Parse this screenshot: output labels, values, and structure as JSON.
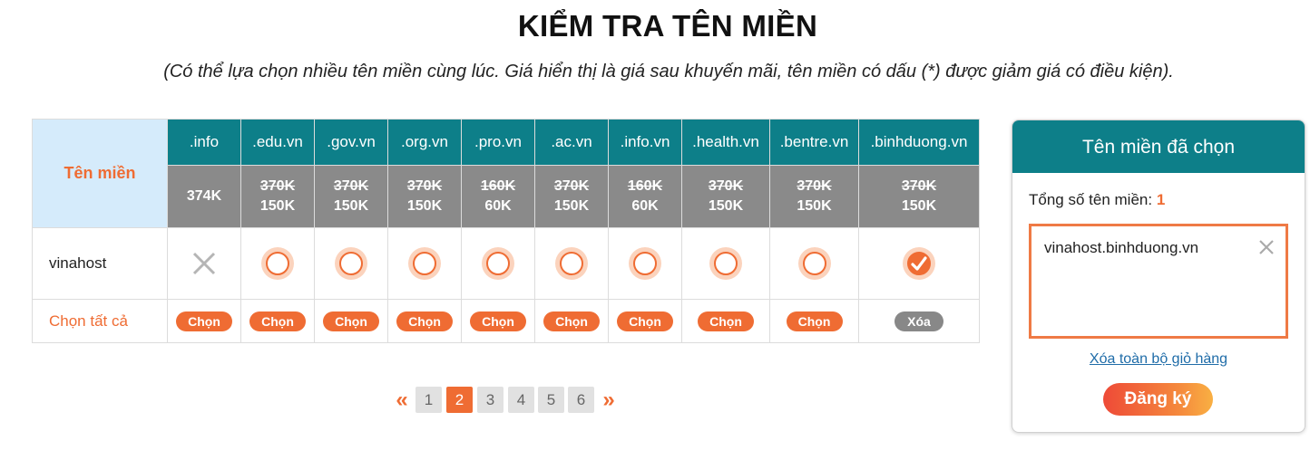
{
  "page": {
    "title": "KIỂM TRA TÊN MIỀN",
    "subtitle": "(Có thể lựa chọn nhiều tên miền cùng lúc. Giá hiển thị là giá sau khuyến mãi, tên miền có dấu (*) được giảm giá có điều kiện)."
  },
  "table": {
    "corner_label": "Tên miền",
    "domain_name": "vinahost",
    "select_all_label": "Chọn tất cả",
    "columns": [
      {
        "ext": ".info",
        "old_price": "",
        "price": "374K",
        "status": "unavailable",
        "action": "Chọn"
      },
      {
        "ext": ".edu.vn",
        "old_price": "370K",
        "price": "150K",
        "status": "available",
        "action": "Chọn"
      },
      {
        "ext": ".gov.vn",
        "old_price": "370K",
        "price": "150K",
        "status": "available",
        "action": "Chọn"
      },
      {
        "ext": ".org.vn",
        "old_price": "370K",
        "price": "150K",
        "status": "available",
        "action": "Chọn"
      },
      {
        "ext": ".pro.vn",
        "old_price": "160K",
        "price": "60K",
        "status": "available",
        "action": "Chọn"
      },
      {
        "ext": ".ac.vn",
        "old_price": "370K",
        "price": "150K",
        "status": "available",
        "action": "Chọn"
      },
      {
        "ext": ".info.vn",
        "old_price": "160K",
        "price": "60K",
        "status": "available",
        "action": "Chọn"
      },
      {
        "ext": ".health.vn",
        "old_price": "370K",
        "price": "150K",
        "status": "available",
        "action": "Chọn"
      },
      {
        "ext": ".bentre.vn",
        "old_price": "370K",
        "price": "150K",
        "status": "available",
        "action": "Chọn"
      },
      {
        "ext": ".binhduong.vn",
        "old_price": "370K",
        "price": "150K",
        "status": "selected",
        "action": "Xóa"
      }
    ]
  },
  "pagination": {
    "prev": "«",
    "next": "»",
    "pages": [
      "1",
      "2",
      "3",
      "4",
      "5",
      "6"
    ],
    "current": "2"
  },
  "cart": {
    "title": "Tên miền đã chọn",
    "total_label": "Tổng số tên miền: ",
    "total_count": "1",
    "items": [
      "vinahost.binhduong.vn"
    ],
    "clear_all": "Xóa toàn bộ giỏ hàng",
    "register": "Đăng ký"
  },
  "colors": {
    "accent": "#ef6c33",
    "header_teal": "#0d7f89",
    "price_grey": "#8a8a8a",
    "corner_blue": "#d5ebfb"
  }
}
